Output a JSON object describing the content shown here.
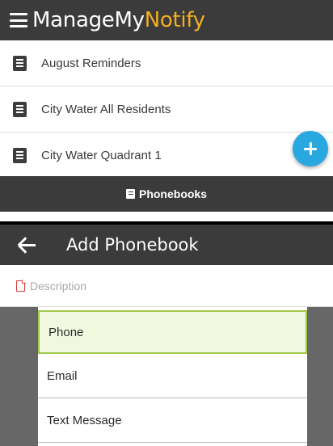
{
  "app": {
    "brand_part1": "ManageMy",
    "brand_part2": "Notify"
  },
  "phonebook_list": {
    "items": [
      {
        "label": "August Reminders"
      },
      {
        "label": "City Water All Residents"
      },
      {
        "label": "City Water Quadrant 1"
      }
    ]
  },
  "bottom_nav": {
    "label": "Phonebooks"
  },
  "add_phonebook": {
    "title": "Add Phonebook",
    "description_placeholder": "Description"
  },
  "dropdown": {
    "selected": "Phone",
    "options": [
      "Phone",
      "Email",
      "Text Message"
    ]
  },
  "colors": {
    "appbar_bg": "#3b3b3b",
    "brand_accent": "#f2b021",
    "fab_blue": "#29a8e0",
    "selected_bg": "#f1f8de",
    "selected_border": "#a3c94a",
    "description_icon": "#e03a3a"
  },
  "icons": {
    "menu": "hamburger-icon",
    "list_item": "document-icon",
    "fab": "plus-icon",
    "nav": "phonebook-icon",
    "back": "back-arrow-icon",
    "description": "file-icon"
  }
}
